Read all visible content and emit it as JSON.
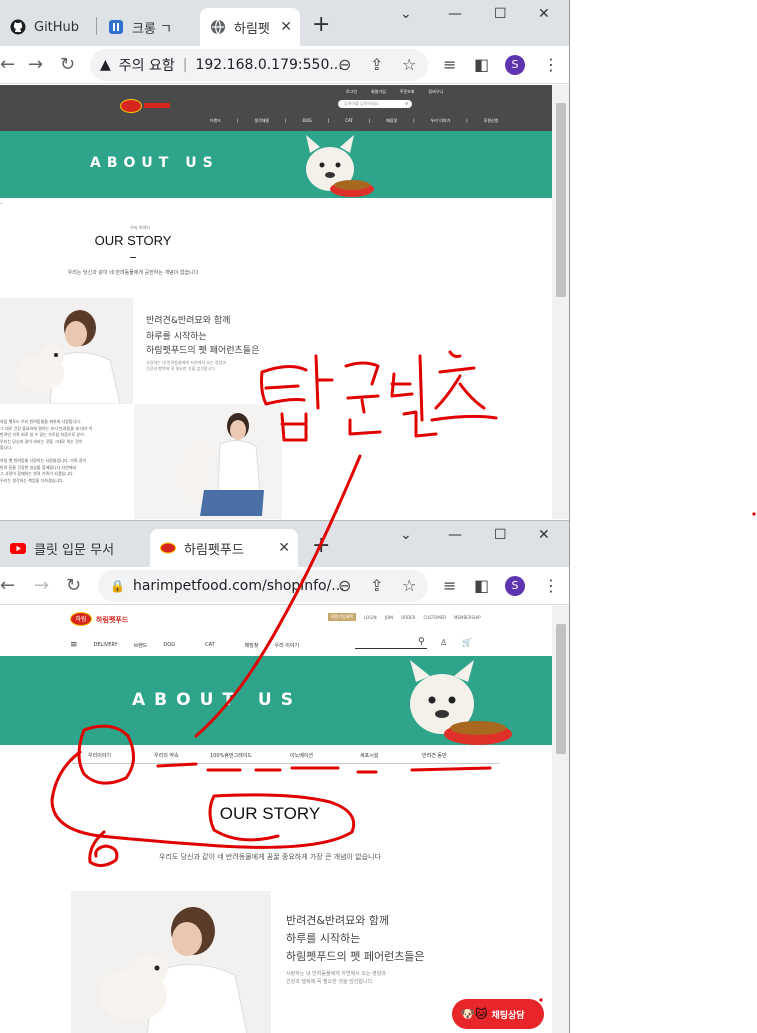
{
  "colors": {
    "teal": "#2ea58a",
    "dark_header": "#4a4a4a",
    "ink": "#e00000",
    "brand_red": "#d7261e"
  },
  "top_window": {
    "tabs": [
      {
        "label": "GitHub",
        "icon": "github-icon"
      },
      {
        "label": "크롱 ㄱ",
        "icon": "crong-icon"
      },
      {
        "label": "하림펫",
        "icon": "globe-icon"
      }
    ],
    "address": {
      "warning": "주의 요함",
      "url": "192.168.0.179:550..."
    },
    "site": {
      "top_links": [
        "로그인",
        "회원가입",
        "주문조회",
        "장바구니"
      ],
      "search_placeholder": "검색어를 입력하세요",
      "menu": [
        "브랜드",
        "생각채용",
        "DOG",
        "CAT",
        "매장찾",
        "우리 이야기",
        "후원신청"
      ],
      "banner_title": "ABOUT US",
      "story_small": "우리 이야기",
      "story_title": "OUR STORY",
      "story_sub": "우리는 당신과 같이 네 반려동물에게 공헌하는 개념이 없습니다",
      "feature_line1": "반려견&반려묘와 함께",
      "feature_line2": "하루를 시작하는",
      "feature_line3": "하림펫푸드의 펫 페어런츠들은",
      "feature_desc1": "사랑하는 내 반려동물에게 자연에서 오는 영양과",
      "feature_desc2": "건강과 행복에 꼭 필요한 것을 엄선합니다.",
      "left_paragraph": [
        "하림 펫푸드 우리 반려동물을 위하여 사랑합니다.",
        "그 대로 건강 중요하게 말하는 보시 반려동물 세 대가 이",
        "반려인 가족 비로 일 수 있는 가르칩 처음으로 같이",
        "우리는 당신과 같이 바라는 것을 그대로 하는 것이",
        "합니다.",
        "",
        "하림 펫 반려동물 사랑하는 사람들입니다. 가족 같이",
        "반려 동물 건강한 일상을 함께합니다 자연에서",
        "그 사랑이 함께하는 반려 가족이 되겠습니다.",
        "우리는 생각하는 책임을 다하겠습니다."
      ]
    }
  },
  "bottom_window": {
    "tabs": [
      {
        "label": "클릿 입문 무서",
        "icon": "youtube-icon"
      },
      {
        "label": "하림펫푸드",
        "icon": "harim-icon"
      }
    ],
    "address": {
      "url": "harimpetfood.com/shopinfo/..."
    },
    "site": {
      "logo_text": "하림펫푸드",
      "logo_badge": "하림",
      "top_links": [
        "회원가입혜택",
        "LOGIN",
        "JOIN",
        "ORDER",
        "CUSTOMER",
        "MEMBERSHIP"
      ],
      "menu": [
        "DELIVERY",
        "브랜드",
        "DOG",
        "CAT",
        "매장찾",
        "우리 이야기"
      ],
      "banner_title": "ABOUT US",
      "sub_tabs": [
        "우리이야기",
        "우리의 약속",
        "100%휴먼그레이드",
        "이노베이션",
        "세포시설",
        "반려견 동반"
      ],
      "story_title": "OUR STORY",
      "story_sub": "우리도 당신과 같이 네 반려동물에게 꿈꿀 중요하게 가장 큰 개념이 없습니다",
      "feature_line1": "반려견&반려묘와 함께",
      "feature_line2": "하루를 시작하는",
      "feature_line3": "하림펫푸드의 펫 페어런츠들은",
      "feature_desc1": "사랑하는 내 반려동물에게 자연에서 오는 영양과",
      "feature_desc2": "건강과 행복에 꼭 필요한 것을 엄선합니다.",
      "chat_label": "채팅상담"
    }
  },
  "annotation": {
    "handwriting": "탭콘텐츠"
  }
}
